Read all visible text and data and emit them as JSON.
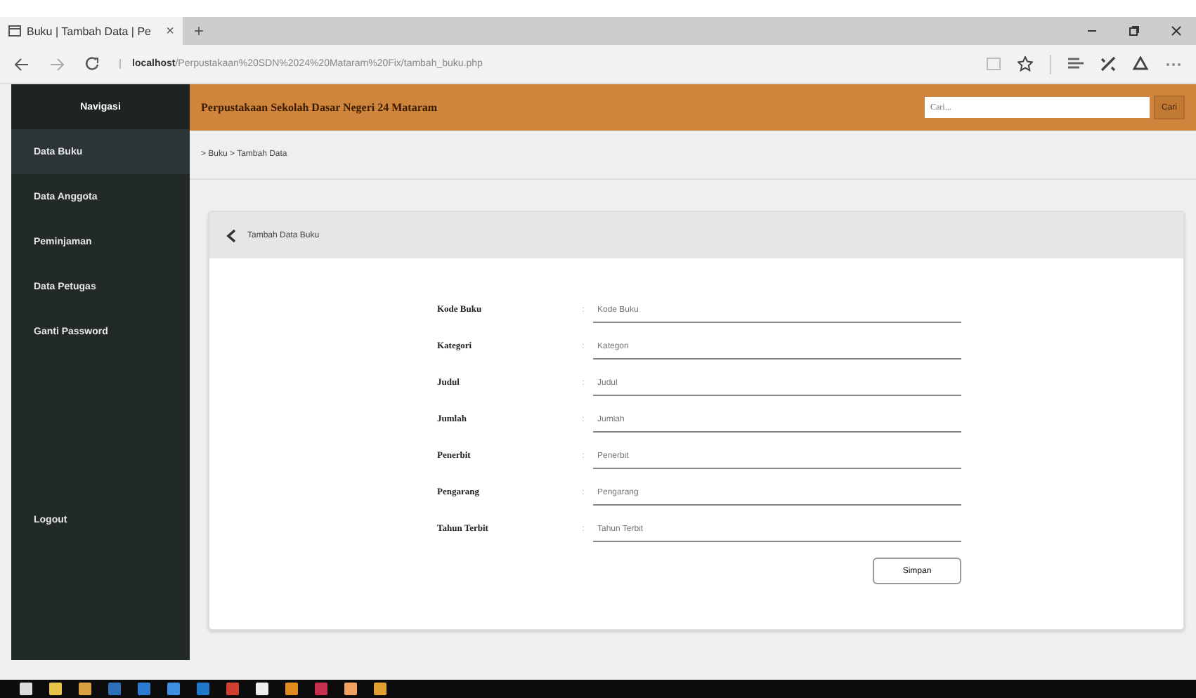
{
  "browser": {
    "tab_title": "Buku | Tambah Data | Pe",
    "tab_close": "×",
    "new_tab": "+",
    "url_host": "localhost",
    "url_path": "/Perpustakaan%20SDN%2024%20Mataram%20Fix/tambah_buku.php"
  },
  "sidebar": {
    "title": "Navigasi",
    "items": [
      {
        "label": "Data Buku",
        "selected": true
      },
      {
        "label": "Data Anggota",
        "selected": false
      },
      {
        "label": "Peminjaman",
        "selected": false
      },
      {
        "label": "Data Petugas",
        "selected": false
      },
      {
        "label": "Ganti Password",
        "selected": false
      }
    ],
    "logout": "Logout"
  },
  "header": {
    "title": "Perpustakaan Sekolah Dasar Negeri 24 Mataram",
    "search": {
      "placeholder": "Cari..."
    },
    "search_button": "Cari"
  },
  "breadcrumb": "> Buku > Tambah Data",
  "panel": {
    "title": "Tambah Data Buku",
    "fields": [
      {
        "label": "Kode Buku",
        "placeholder": "Kode Buku"
      },
      {
        "label": "Kategori",
        "placeholder": "Kategori"
      },
      {
        "label": "Judul",
        "placeholder": "Judul"
      },
      {
        "label": "Jumlah",
        "placeholder": "Jumlah"
      },
      {
        "label": "Penerbit",
        "placeholder": "Penerbit"
      },
      {
        "label": "Pengarang",
        "placeholder": "Pengarang"
      },
      {
        "label": "Tahun Terbit",
        "placeholder": "Tahun Terbit"
      }
    ],
    "colon": ":",
    "submit": "Simpan"
  }
}
